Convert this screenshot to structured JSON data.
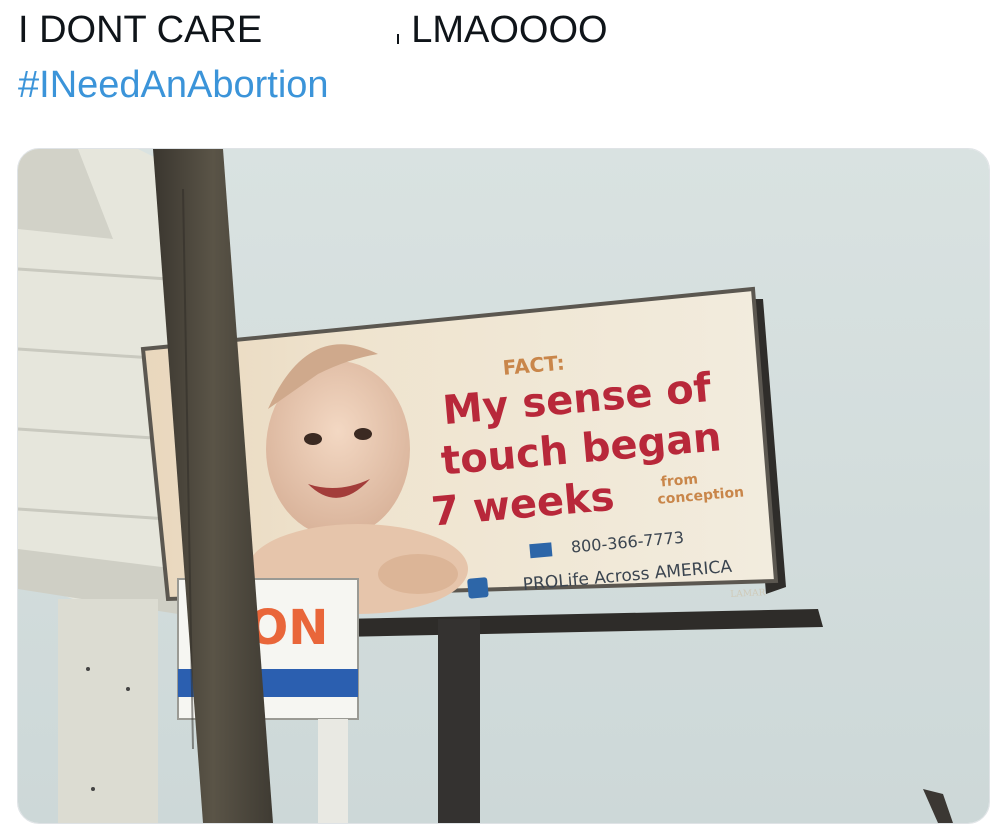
{
  "tweet": {
    "text_part1": "I DONT CARE",
    "text_part2": "LMAOOOO",
    "hashtag": "#INeedAnAbortion"
  },
  "media": {
    "billboard": {
      "kicker": "FACT:",
      "line1": "My sense of",
      "line2": "touch began",
      "line3": "7 weeks",
      "from": "from",
      "conception": "conception",
      "phone": "800-366-7773",
      "org": "PROLife Across AMERICA",
      "frame_brand": "LAMAR"
    },
    "sign_text": "ON",
    "colors": {
      "sky": "#d5dfdf",
      "billboard_bg": "#f0e8d6",
      "headline": "#b8283a",
      "kicker": "#c9864a",
      "pole": "#4a463e"
    }
  }
}
